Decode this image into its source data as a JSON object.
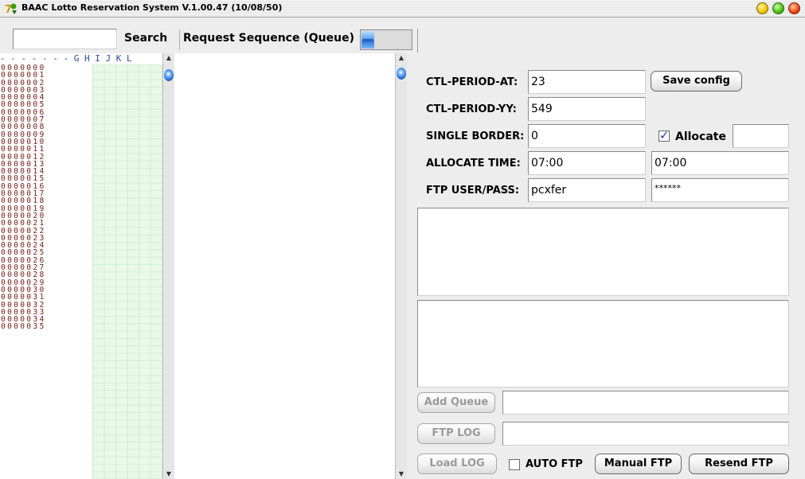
{
  "window": {
    "title": "BAAC Lotto Reservation System V.1.00.47 (10/08/50)"
  },
  "toolbar": {
    "search_value": "",
    "search_label": "Search",
    "queue_label": "Request Sequence (Queue)",
    "progress_fraction": 0.25
  },
  "table": {
    "header": "- - - - - - - G H I J K L",
    "rows": [
      "0000000",
      "0000001",
      "0000002",
      "0000003",
      "0000004",
      "0000005",
      "0000006",
      "0000007",
      "0000008",
      "0000009",
      "0000010",
      "0000011",
      "0000012",
      "0000013",
      "0000014",
      "0000015",
      "0000016",
      "0000017",
      "0000018",
      "0000019",
      "0000020",
      "0000021",
      "0000022",
      "0000023",
      "0000024",
      "0000025",
      "0000026",
      "0000027",
      "0000028",
      "0000029",
      "0000030",
      "0000031",
      "0000032",
      "0000033",
      "0000034",
      "0000035"
    ]
  },
  "config": {
    "period_at_label": "CTL-PERIOD-AT:",
    "period_at_value": "23",
    "save_config_label": "Save config",
    "period_yy_label": "CTL-PERIOD-YY:",
    "period_yy_value": "549",
    "single_border_label": "SINGLE BORDER:",
    "single_border_value": "0",
    "allocate_label": "Allocate",
    "allocate_checked": true,
    "allocate_value": "",
    "allocate_time_label": "ALLOCATE TIME:",
    "allocate_time_value": "07:00",
    "allocate_time_value2": "07:00",
    "ftp_label": "FTP USER/PASS:",
    "ftp_user": "pcxfer",
    "ftp_pass": "******"
  },
  "actions": {
    "add_queue_label": "Add Queue",
    "add_queue_value": "",
    "ftp_log_label": "FTP LOG",
    "ftp_log_value": "",
    "load_log_label": "Load LOG",
    "auto_ftp_label": "AUTO FTP",
    "auto_ftp_checked": false,
    "manual_ftp_label": "Manual FTP",
    "resend_ftp_label": "Resend FTP"
  }
}
